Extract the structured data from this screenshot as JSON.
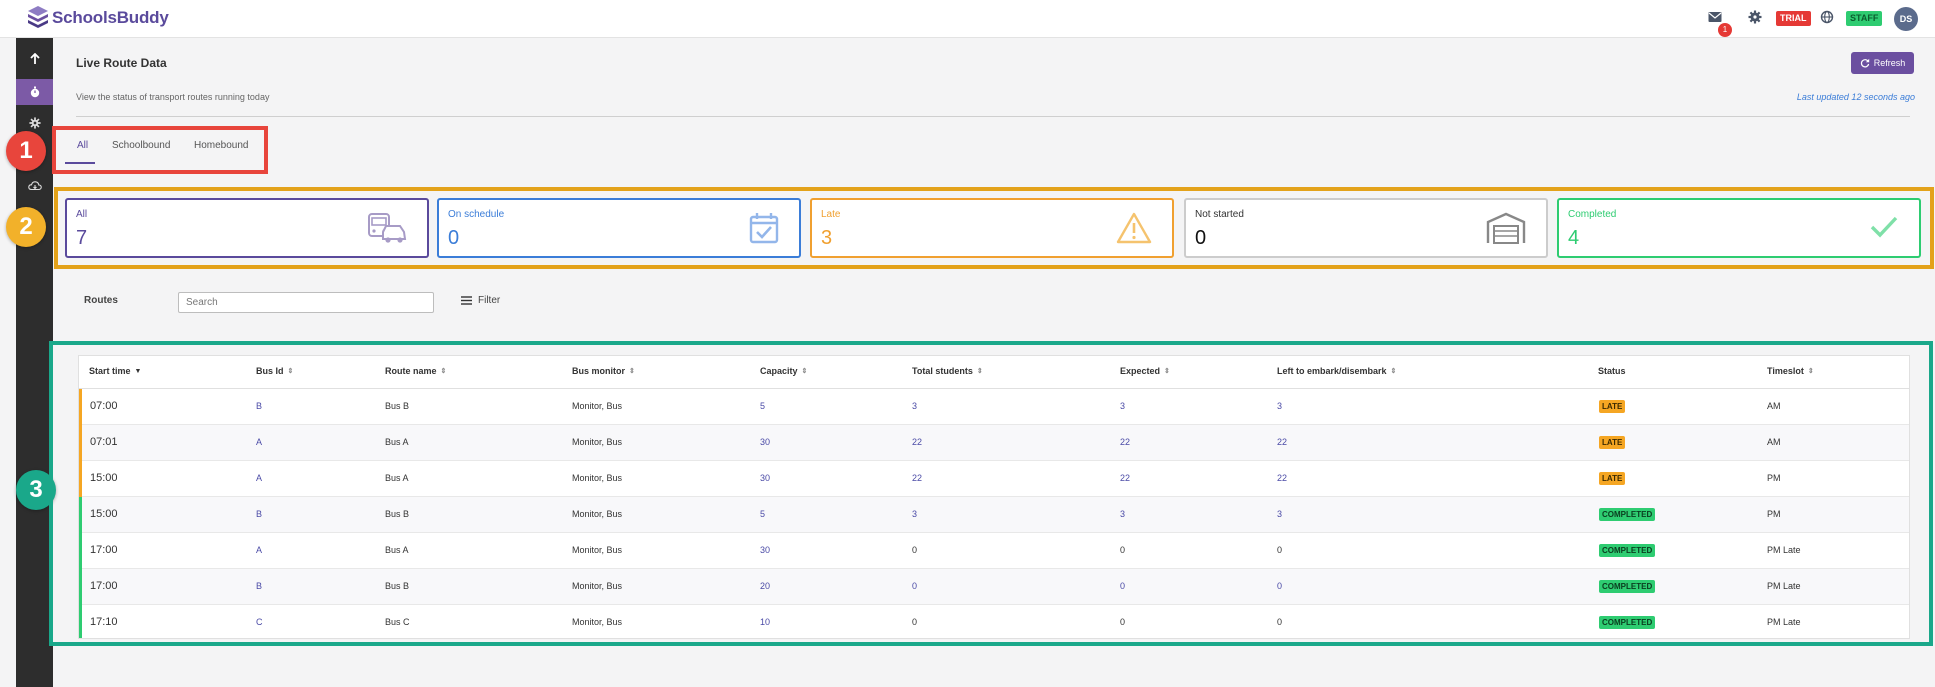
{
  "app": {
    "name": "SchoolsBuddy"
  },
  "topbar": {
    "mail_count": "1",
    "trial_label": "TRIAL",
    "staff_label": "STAFF",
    "avatar_initials": "DS"
  },
  "callouts": [
    "1",
    "2",
    "3"
  ],
  "header": {
    "title": "Live Route Data",
    "subtitle": "View the status of transport routes running today",
    "last_updated": "Last updated 12 seconds ago",
    "refresh_label": "Refresh"
  },
  "tabs": [
    {
      "label": "All",
      "active": true
    },
    {
      "label": "Schoolbound",
      "active": false
    },
    {
      "label": "Homebound",
      "active": false
    }
  ],
  "cards": [
    {
      "label": "All",
      "value": "7",
      "color": "#5a4a9c",
      "icon": "bus-car-icon"
    },
    {
      "label": "On schedule",
      "value": "0",
      "color": "#3b7dd8",
      "icon": "calendar-check-icon"
    },
    {
      "label": "Late",
      "value": "3",
      "color": "#f0a030",
      "icon": "warning-icon"
    },
    {
      "label": "Not started",
      "value": "0",
      "color": "#333333",
      "icon": "garage-icon"
    },
    {
      "label": "Completed",
      "value": "4",
      "color": "#2ecc71",
      "icon": "checkmark-icon"
    }
  ],
  "filter": {
    "routes_label": "Routes",
    "search_placeholder": "Search",
    "filter_label": "Filter"
  },
  "table": {
    "columns": [
      "Start time",
      "Bus Id",
      "Route name",
      "Bus monitor",
      "Capacity",
      "Total students",
      "Expected",
      "Left to embark/disembark",
      "Status",
      "Timeslot"
    ],
    "rows": [
      {
        "start": "07:00",
        "bus_id": "B",
        "route": "Bus B",
        "monitor": "Monitor, Bus",
        "capacity": "5",
        "total": "3",
        "expected": "3",
        "left": "3",
        "status": "LATE",
        "timeslot": "AM"
      },
      {
        "start": "07:01",
        "bus_id": "A",
        "route": "Bus A",
        "monitor": "Monitor, Bus",
        "capacity": "30",
        "total": "22",
        "expected": "22",
        "left": "22",
        "status": "LATE",
        "timeslot": "AM"
      },
      {
        "start": "15:00",
        "bus_id": "A",
        "route": "Bus A",
        "monitor": "Monitor, Bus",
        "capacity": "30",
        "total": "22",
        "expected": "22",
        "left": "22",
        "status": "LATE",
        "timeslot": "PM"
      },
      {
        "start": "15:00",
        "bus_id": "B",
        "route": "Bus B",
        "monitor": "Monitor, Bus",
        "capacity": "5",
        "total": "3",
        "expected": "3",
        "left": "3",
        "status": "COMPLETED",
        "timeslot": "PM"
      },
      {
        "start": "17:00",
        "bus_id": "A",
        "route": "Bus A",
        "monitor": "Monitor, Bus",
        "capacity": "30",
        "total": "0",
        "expected": "0",
        "left": "0",
        "status": "COMPLETED",
        "timeslot": "PM Late"
      },
      {
        "start": "17:00",
        "bus_id": "B",
        "route": "Bus B",
        "monitor": "Monitor, Bus",
        "capacity": "20",
        "total": "0",
        "expected": "0",
        "left": "0",
        "status": "COMPLETED",
        "timeslot": "PM Late"
      },
      {
        "start": "17:10",
        "bus_id": "C",
        "route": "Bus C",
        "monitor": "Monitor, Bus",
        "capacity": "10",
        "total": "0",
        "expected": "0",
        "left": "0",
        "status": "COMPLETED",
        "timeslot": "PM Late"
      }
    ]
  },
  "colors": {
    "accent": "#5a4a9c",
    "late": "#f5a623",
    "completed": "#2ecc71",
    "callout_1": "#e8453c",
    "callout_2": "#f2b12a",
    "callout_3": "#1aa88a"
  }
}
